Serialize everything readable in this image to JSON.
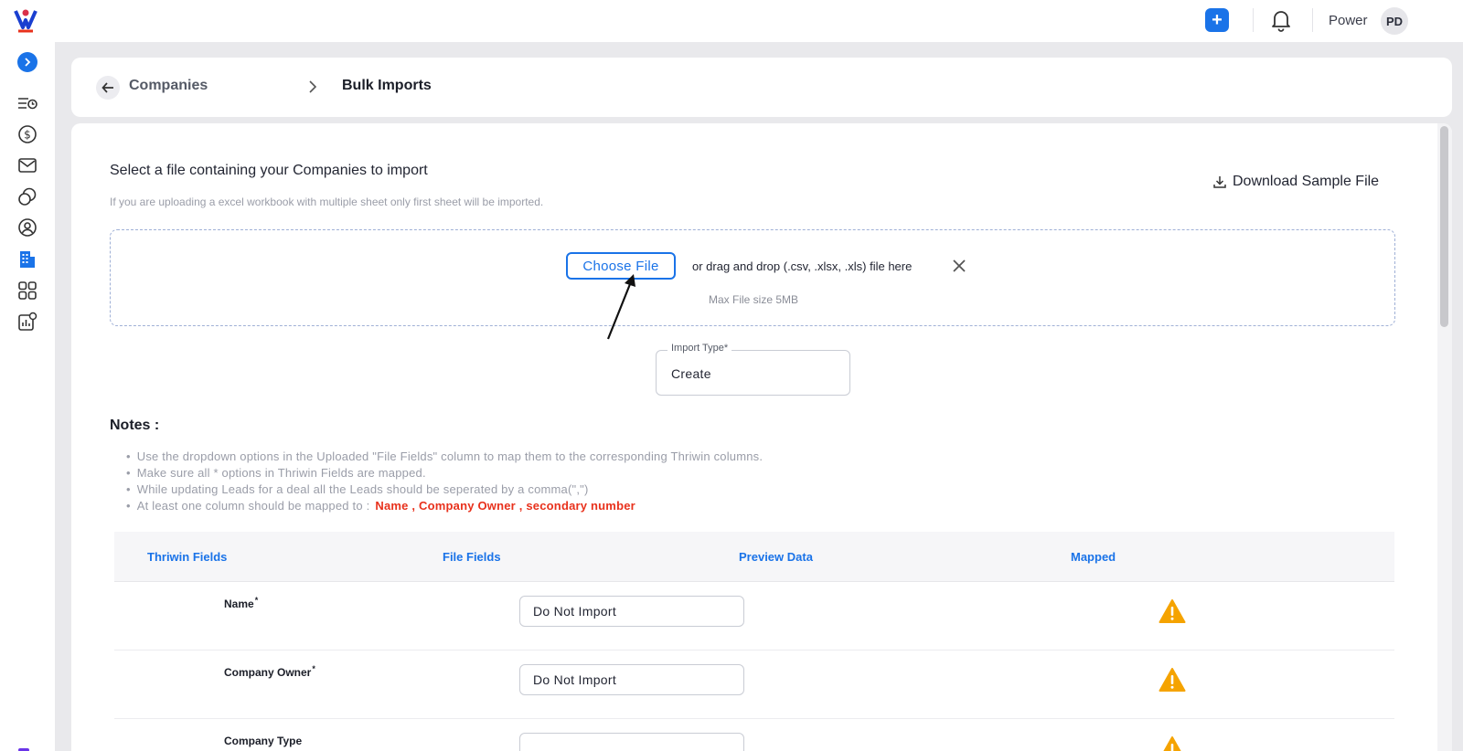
{
  "topbar": {
    "user_name": "Power",
    "avatar_initials": "PD",
    "add_label": "+"
  },
  "breadcrumb": {
    "parent": "Companies",
    "current": "Bulk Imports"
  },
  "upload": {
    "title": "Select a file containing your Companies to import",
    "subtitle": "If you are uploading a excel workbook with multiple sheet only first sheet will be imported.",
    "download_label": "Download Sample File",
    "choose_label": "Choose File",
    "drag_text": "or drag and drop (.csv, .xlsx, .xls) file here",
    "max_size": "Max File size 5MB"
  },
  "import_type": {
    "label": "Import Type*",
    "value": "Create"
  },
  "notes": {
    "title": "Notes :",
    "items": [
      "Use the dropdown options in the Uploaded \"File Fields\" column to map them to the corresponding Thriwin columns.",
      "Make sure all * options in Thriwin Fields are mapped.",
      "While updating Leads for a deal all the Leads should be seperated by a comma(\",\")",
      "At least one column should be mapped to :"
    ],
    "required_fields": "Name , Company Owner , secondary number"
  },
  "table": {
    "headers": [
      "Thriwin Fields",
      "File Fields",
      "Preview Data",
      "Mapped"
    ],
    "rows": [
      {
        "field": "Name",
        "required": "*",
        "file_field": "Do Not Import"
      },
      {
        "field": "Company Owner",
        "required": "*",
        "file_field": "Do Not Import"
      },
      {
        "field": "Company Type",
        "required": "",
        "file_field": ""
      }
    ]
  },
  "colors": {
    "accent": "#1a73e8",
    "warning": "#f5a300",
    "highlight": "#e8311c"
  }
}
